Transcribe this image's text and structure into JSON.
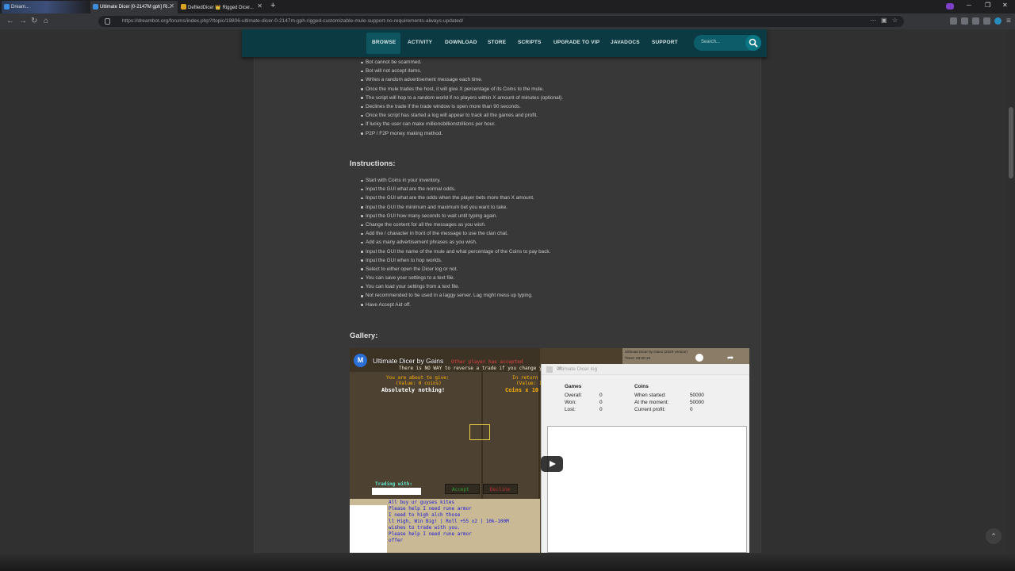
{
  "browser": {
    "tabs": [
      {
        "label": "Dream..."
      },
      {
        "label": "Ultimate Dicer [0-2147M gph] Ri..."
      },
      {
        "label": "DefiledDicer 👑 Rigged Dicer..."
      }
    ],
    "url": "https://dreambot.org/forums/index.php?/topic/19806-ultimate-dicer-0-2147m-gph-rigged-customizable-mule-support-no-requirements-always-updated/"
  },
  "sitenav": {
    "items": [
      "BROWSE",
      "ACTIVITY",
      "DOWNLOAD",
      "STORE",
      "SCRIPTS",
      "UPGRADE TO VIP",
      "JAVADOCS",
      "SUPPORT"
    ],
    "search_placeholder": "Search..."
  },
  "features": [
    "Bot cannot be scammed.",
    "Bot will not accept items.",
    "Writes a random advertisement message each time.",
    "Once the mule trades the host, it will give X percentage of its Coins to the mule.",
    "The script will hop to a random world if no players within X amount of minutes (optional).",
    "Declines the trade if the trade window is open more than 90 seconds.",
    "Once the script has started a log will appear to track all the games and profit.",
    "If lucky the user can make millionsbillionstrillions per hour.",
    "P2P / F2P money making method."
  ],
  "instructions": {
    "heading": "Instructions:",
    "items": [
      "Start with Coins in your inventory.",
      "Input the GUI what are the normal odds.",
      "Input the GUI what are the odds when the player bets more than X amount.",
      "Input the GUI the minimum and maximum bet you want to take.",
      "Input the GUI how many seconds to wait until typing again.",
      "Change the content for all the messages as you wish.",
      "Add the / character in front of the message to use the clan chat.",
      "Add as many advertisement phrases as you wish.",
      "Input the GUI the name of the mule and what percentage of the Coins to pay back.",
      "Input the GUI when to hop worlds.",
      "Select to either open the Dicer log or not.",
      "You can save your settings to a text file.",
      "You can load your settings from a text file.",
      "Not recommended to be used in a laggy server. Lag might mess up typing.",
      "Have Accept Aid off."
    ]
  },
  "gallery": {
    "heading": "Gallery:",
    "video": {
      "channel_initial": "M",
      "title": "Ultimate Dicer by Gains",
      "top_overlay_1": "Other player has accepted",
      "top_overlay_2": "There is NO WAY to reverse a trade if you change y",
      "give_label": "You are about to give:",
      "give_value": "(Value: 0 coins)",
      "give_items": "Absolutely nothing!",
      "return_label": "In return y",
      "return_value": "(Value: 1",
      "return_items": "Coins x 10",
      "trading_with": "Trading with:",
      "accept": "Accept",
      "decline": "Decline",
      "strip_line1": "Ultimate Dicer by Gainz (2020 version)",
      "strip_line2": "Timer: 00:00:15",
      "chat_lines": [
        "All buy ur guyses kites",
        "Please help I need rune armor",
        "I need to high alch those",
        "ll High, Win Big! | Roll +55 x2 | 10k-100M",
        "wishes to trade with you.",
        "Please help I need rune armor",
        "offer"
      ],
      "log": {
        "window_title": "Ultimate Dicer log",
        "games_head": "Games",
        "coins_head": "Coins",
        "overall_label": "Overall:",
        "overall_value": "0",
        "won_label": "Won:",
        "won_value": "0",
        "lost_label": "Lost:",
        "lost_value": "0",
        "started_label": "When started:",
        "started_value": "50000",
        "moment_label": "At the moment:",
        "moment_value": "50000",
        "profit_label": "Current profit:",
        "profit_value": "0"
      }
    }
  },
  "colors": {
    "nav_bg": "#0c3a42",
    "nav_active": "#0e5560",
    "page_bg": "#383838"
  }
}
